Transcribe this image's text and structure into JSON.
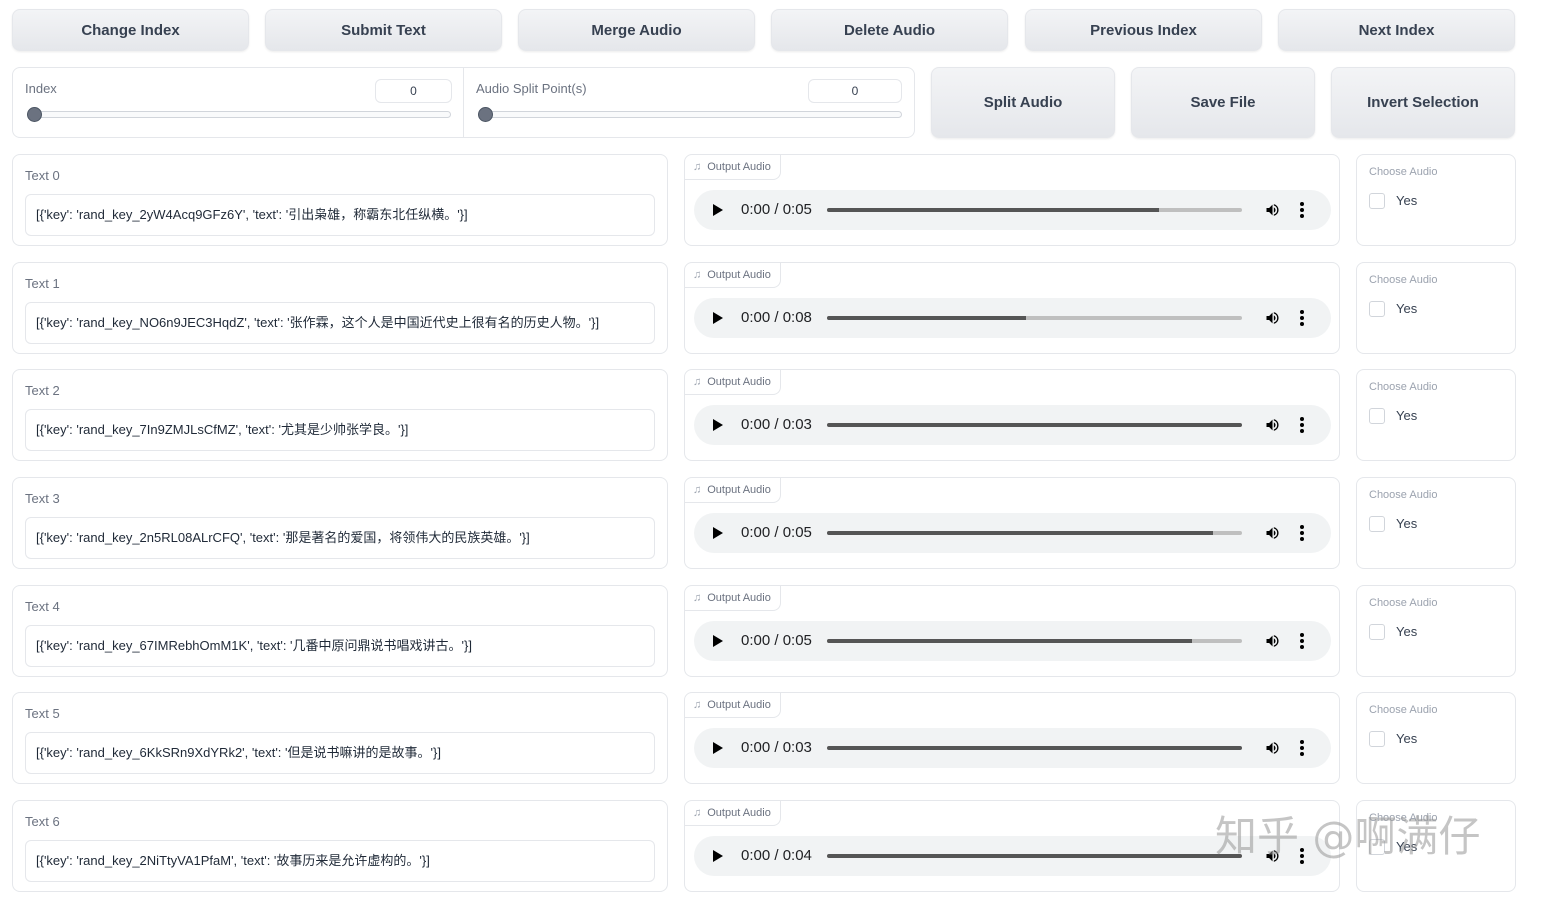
{
  "toolbar": {
    "buttons": [
      "Change Index",
      "Submit Text",
      "Merge Audio",
      "Delete Audio",
      "Previous Index",
      "Next Index"
    ]
  },
  "controls": {
    "index_label": "Index",
    "index_value": "0",
    "split_label": "Audio Split Point(s)",
    "split_value": "0",
    "split_audio": "Split Audio",
    "save_file": "Save File",
    "invert_selection": "Invert Selection"
  },
  "rows": [
    {
      "label": "Text 0",
      "text": "[{'key': 'rand_key_2yW4Acq9GFz6Y', 'text': '引出枭雄，称霸东北任纵横。'}]",
      "audio_label": "Output Audio",
      "time": "0:00 / 0:05",
      "progress": 0.8,
      "choose_label": "Choose Audio",
      "choice": "Yes"
    },
    {
      "label": "Text 1",
      "text": "[{'key': 'rand_key_NO6n9JEC3HqdZ', 'text': '张作霖，这个人是中国近代史上很有名的历史人物。'}]",
      "audio_label": "Output Audio",
      "time": "0:00 / 0:08",
      "progress": 0.48,
      "choose_label": "Choose Audio",
      "choice": "Yes"
    },
    {
      "label": "Text 2",
      "text": "[{'key': 'rand_key_7In9ZMJLsCfMZ', 'text': '尤其是少帅张学良。'}]",
      "audio_label": "Output Audio",
      "time": "0:00 / 0:03",
      "progress": 1.0,
      "choose_label": "Choose Audio",
      "choice": "Yes"
    },
    {
      "label": "Text 3",
      "text": "[{'key': 'rand_key_2n5RL08ALrCFQ', 'text': '那是著名的爱国，将领伟大的民族英雄。'}]",
      "audio_label": "Output Audio",
      "time": "0:00 / 0:05",
      "progress": 0.93,
      "choose_label": "Choose Audio",
      "choice": "Yes"
    },
    {
      "label": "Text 4",
      "text": "[{'key': 'rand_key_67IMRebhOmM1K', 'text': '几番中原问鼎说书唱戏讲古。'}]",
      "audio_label": "Output Audio",
      "time": "0:00 / 0:05",
      "progress": 0.88,
      "choose_label": "Choose Audio",
      "choice": "Yes"
    },
    {
      "label": "Text 5",
      "text": "[{'key': 'rand_key_6KkSRn9XdYRk2', 'text': '但是说书嘛讲的是故事。'}]",
      "audio_label": "Output Audio",
      "time": "0:00 / 0:03",
      "progress": 1.0,
      "choose_label": "Choose Audio",
      "choice": "Yes"
    },
    {
      "label": "Text 6",
      "text": "[{'key': 'rand_key_2NiTtyVA1PfaM', 'text': '故事历来是允许虚构的。'}]",
      "audio_label": "Output Audio",
      "time": "0:00 / 0:04",
      "progress": 1.0,
      "choose_label": "Choose Audio",
      "choice": "Yes"
    }
  ],
  "watermark": "知乎 @啊满仔"
}
